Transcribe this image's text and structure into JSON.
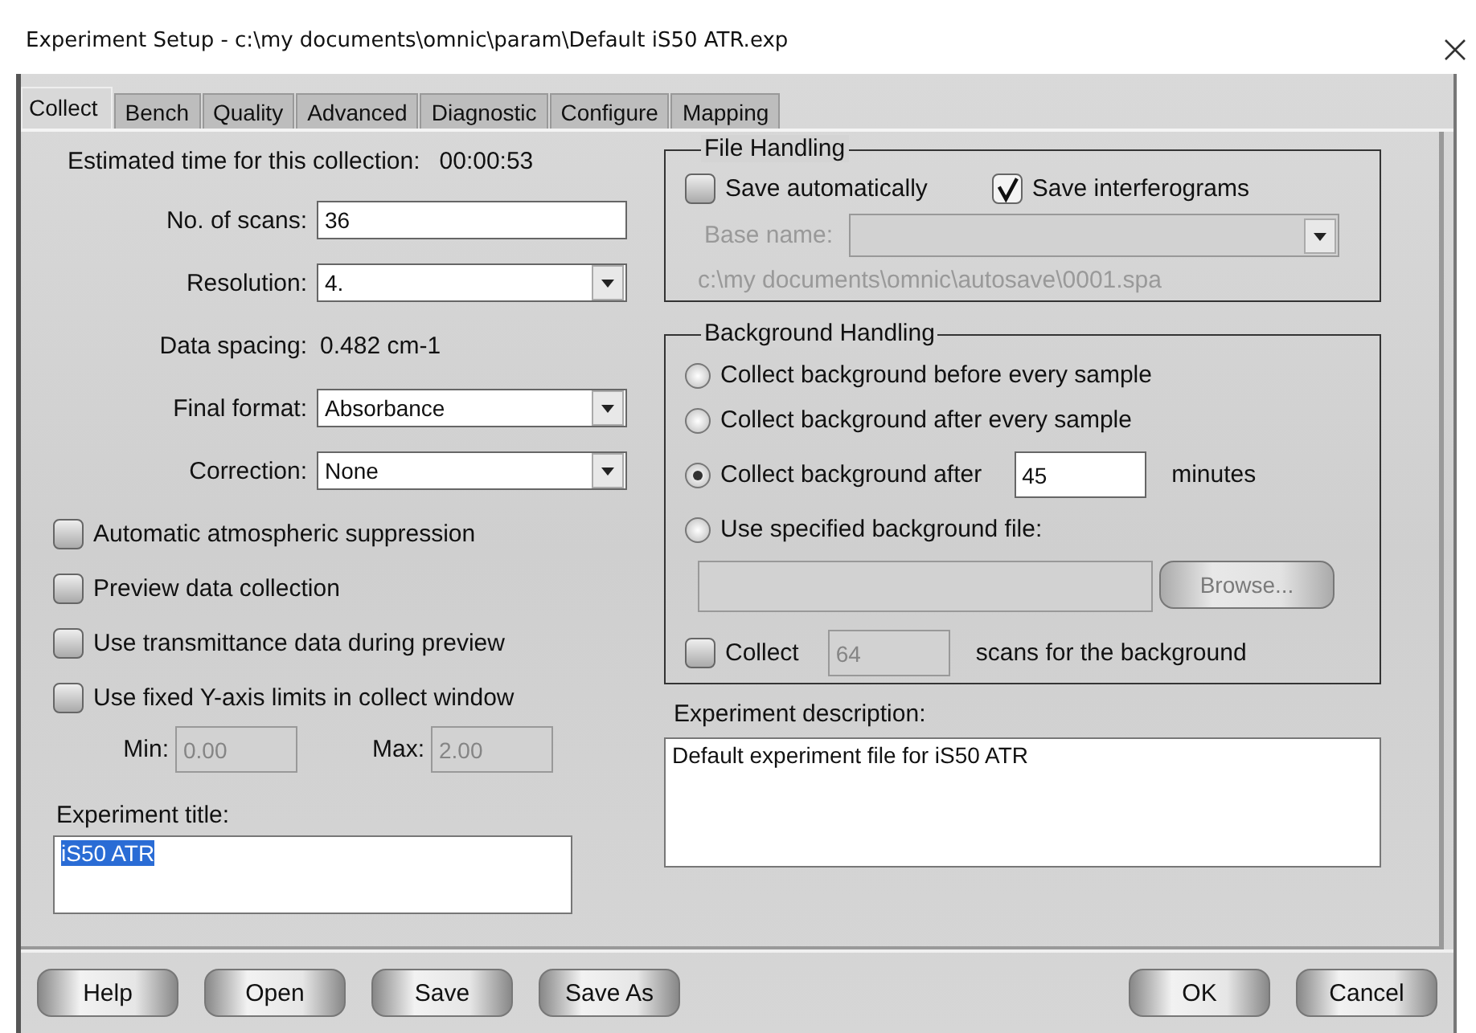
{
  "window": {
    "title": "Experiment Setup - c:\\my documents\\omnic\\param\\Default iS50 ATR.exp"
  },
  "tabs": [
    {
      "label": "Collect",
      "selected": true
    },
    {
      "label": "Bench",
      "selected": false
    },
    {
      "label": "Quality",
      "selected": false
    },
    {
      "label": "Advanced",
      "selected": false
    },
    {
      "label": "Diagnostic",
      "selected": false
    },
    {
      "label": "Configure",
      "selected": false
    },
    {
      "label": "Mapping",
      "selected": false
    }
  ],
  "estimated_time": {
    "label": "Estimated time for this collection:",
    "value": "00:00:53"
  },
  "fields": [
    {
      "kind": "text",
      "label": "No. of scans:",
      "value": "36"
    },
    {
      "kind": "select",
      "label": "Resolution:",
      "value": "4."
    },
    {
      "kind": "readout",
      "label": "Data spacing:",
      "value": "0.482 cm-1"
    },
    {
      "kind": "select",
      "label": "Final format:",
      "value": "Absorbance"
    },
    {
      "kind": "select",
      "label": "Correction:",
      "value": "None"
    }
  ],
  "options": [
    {
      "label": "Automatic atmospheric suppression",
      "checked": false
    },
    {
      "label": "Preview data collection",
      "checked": false
    },
    {
      "label": "Use transmittance data during preview",
      "checked": false
    },
    {
      "label": "Use fixed Y-axis limits in collect window",
      "checked": false
    }
  ],
  "y_limits": [
    {
      "label": "Min:",
      "value": "0.00",
      "disabled": true
    },
    {
      "label": "Max:",
      "value": "2.00",
      "disabled": true
    }
  ],
  "experiment_title": {
    "label": "Experiment title:",
    "value": "iS50 ATR",
    "highlighted": true
  },
  "file_handling": {
    "title": "File Handling",
    "options": [
      {
        "label": "Save automatically",
        "checked": false
      },
      {
        "label": "Save interferograms",
        "checked": true
      }
    ],
    "base_name": {
      "label": "Base name:",
      "disabled": true
    },
    "path": "c:\\my documents\\omnic\\autosave\\0001.spa"
  },
  "background_handling": {
    "title": "Background Handling",
    "choices": [
      {
        "kind": "plain",
        "label": "Collect background before every sample",
        "selected": false
      },
      {
        "kind": "plain",
        "label": "Collect background after every sample",
        "selected": false
      },
      {
        "kind": "minutes",
        "label": "Collect background after",
        "selected": true,
        "value": "45",
        "unit": "minutes"
      },
      {
        "kind": "file",
        "label": "Use specified background file:",
        "selected": false,
        "button": "Browse...",
        "disabled": true
      }
    ],
    "scans": {
      "label": "Collect",
      "checked": false,
      "value": "64",
      "disabled": true,
      "suffix": "scans for the background"
    }
  },
  "description": {
    "label": "Experiment description:",
    "value": "Default experiment file for iS50 ATR"
  },
  "buttons_left": [
    {
      "label": "Help"
    },
    {
      "label": "Open"
    },
    {
      "label": "Save"
    },
    {
      "label": "Save As"
    }
  ],
  "buttons_right": [
    {
      "label": "OK"
    },
    {
      "label": "Cancel"
    }
  ]
}
